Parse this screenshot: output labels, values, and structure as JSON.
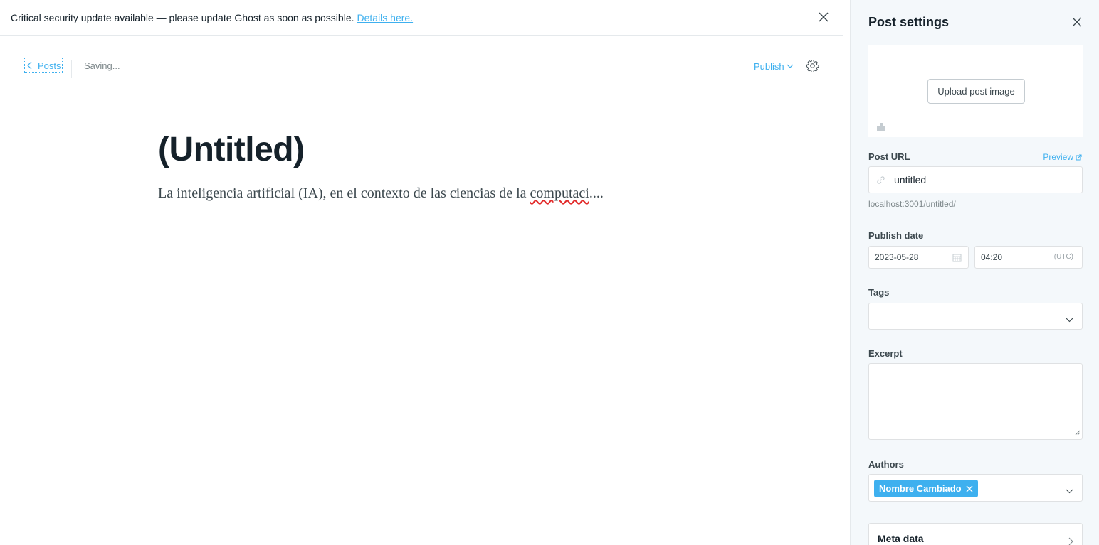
{
  "alert": {
    "message": "Critical security update available — please update Ghost as soon as possible.",
    "link_text": "Details here."
  },
  "header": {
    "back_label": "Posts",
    "status": "Saving...",
    "publish_label": "Publish"
  },
  "editor": {
    "title": "(Untitled)",
    "body_before": "La inteligencia artificial (IA), en el contexto de las ciencias de la ",
    "body_misspelled": "computaci",
    "body_after": "...."
  },
  "settings": {
    "title": "Post settings",
    "upload_label": "Upload post image",
    "post_url_label": "Post URL",
    "preview_label": "Preview",
    "slug": "untitled",
    "url_hint": "localhost:3001/untitled/",
    "publish_date_label": "Publish date",
    "date": "2023-05-28",
    "time": "04:20",
    "timezone": "(UTC)",
    "tags_label": "Tags",
    "excerpt_label": "Excerpt",
    "authors_label": "Authors",
    "author": "Nombre Cambiado",
    "meta_label": "Meta data"
  },
  "colors": {
    "accent": "#3eb0ef",
    "text": "#15212a",
    "panel_bg": "#f4f8fb"
  }
}
